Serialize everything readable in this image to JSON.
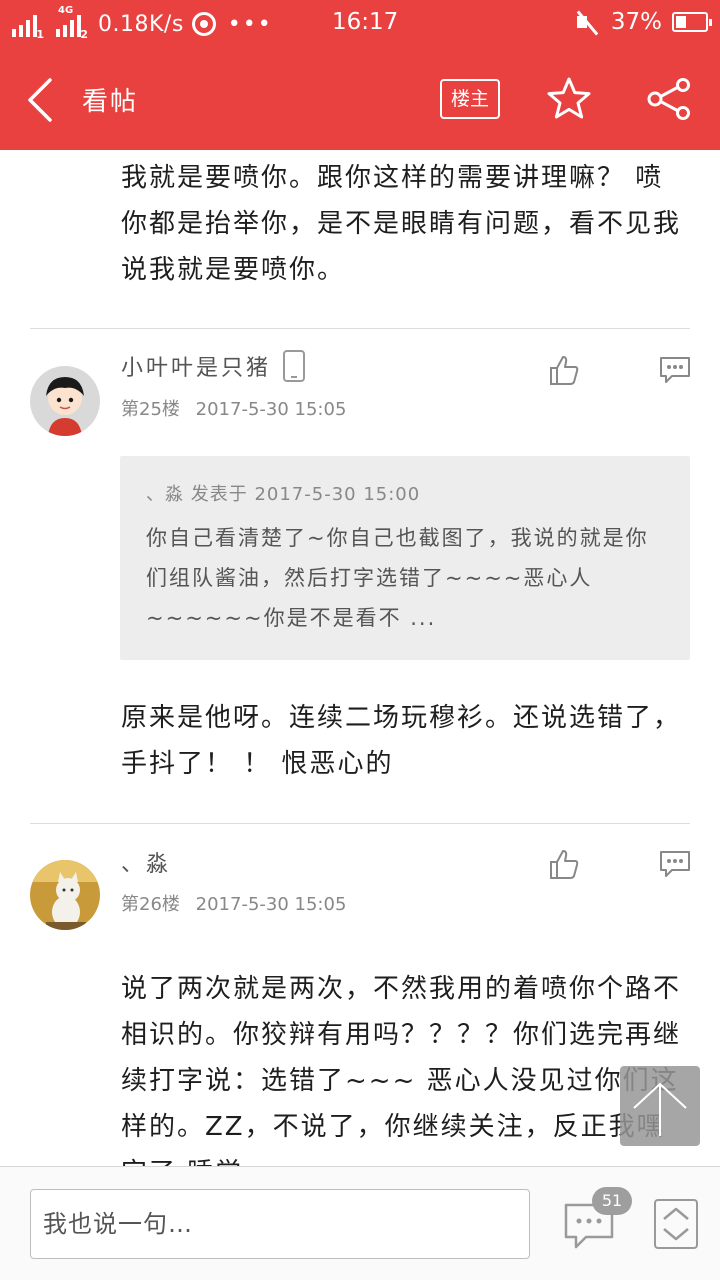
{
  "status_bar": {
    "sim1": "1",
    "sim2": "2",
    "network": "4G",
    "speed": "0.18K/s",
    "dots": "•••",
    "time": "16:17",
    "battery_percent": "37%",
    "battery_level": 0.37
  },
  "titlebar": {
    "back_icon": "chevron-left-icon",
    "title": "看帖",
    "owner_button": "楼主",
    "favorite_icon": "star-icon",
    "share_icon": "share-icon",
    "background": "#e8413f"
  },
  "top_text": "我就是要喷你。跟你这样的需要讲理嘛？ 喷你都是抬举你，是不是眼睛有问题，看不见我说我就是要喷你。",
  "posts": [
    {
      "username": "小叶叶是只猪",
      "floor": "第25楼",
      "time": "2017-5-30 15:05",
      "quote": {
        "header": "、淼 发表于 2017-5-30 15:00",
        "text": "你自己看清楚了~你自己也截图了，我说的就是你们组队酱油，然后打字选错了~~~~恶心人~~~~~~你是不是看不 ..."
      },
      "body": "原来是他呀。连续二场玩穆衫。还说选错了，手抖了！ ！ 恨恶心的"
    },
    {
      "username": "、淼",
      "floor": "第26楼",
      "time": "2017-5-30 15:05",
      "body": "说了两次就是两次，不然我用的着喷你个路不相识的。你狡辩有用吗？？？？你们选完再继续打字说：选错了~~~ 恶心人没见过你们这样的。ZZ，不说了，你继续关注，反正我嘿完了 睡觉"
    }
  ],
  "bottom_bar": {
    "input_placeholder": "我也说一句…",
    "comment_count": "51"
  }
}
